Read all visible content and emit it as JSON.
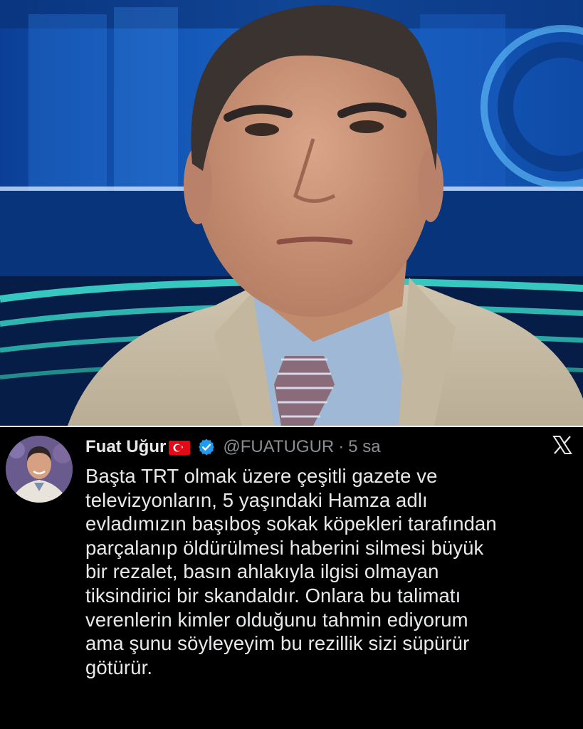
{
  "tweet": {
    "display_name": "Fuat Uğur",
    "flag_icon": "turkey-flag-icon",
    "verified_icon": "verified-badge-icon",
    "handle": "@FUATUGUR",
    "separator": "·",
    "time": "5 sa",
    "platform_icon": "x-logo-icon",
    "text": "Başta TRT olmak üzere çeşitli gazete ve\ntelevizyonların, 5 yaşındaki Hamza adlı\nevladımızın başıboş sokak köpekleri tarafından\nparçalanıp öldürülmesi haberini silmesi büyük\nbir rezalet, basın ahlakıyla ilgisi olmayan\ntiksindirici bir skandaldır. Onlara bu talimatı\nverenlerin kimler olduğunu tahmin ediyorum\nama şunu söyleyeyim bu rezillik sizi süpürür\ngötürür."
  },
  "colors": {
    "tweet_background": "#000000",
    "text": "#e7e9ea",
    "muted": "#8b8f94",
    "verified": "#1d9bf0",
    "flag_red": "#e30a17"
  }
}
